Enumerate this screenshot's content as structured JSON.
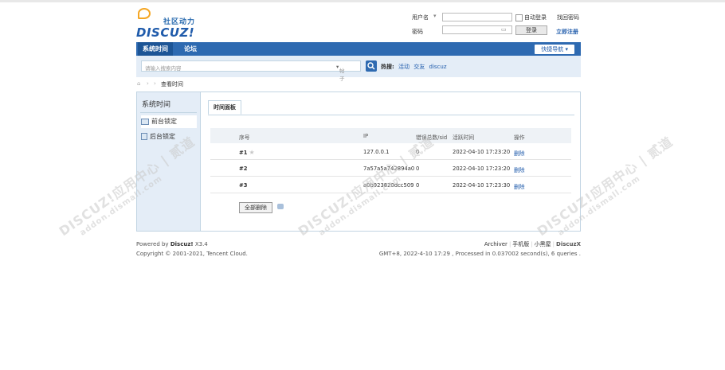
{
  "header": {
    "slogan": "社区动力",
    "brand": "DISCUZ!",
    "login": {
      "username_label": "用户名",
      "password_label": "密码",
      "auto_login_label": "自动登录",
      "forgot_password": "找回密码",
      "login_button": "登录",
      "register_link": "立即注册"
    }
  },
  "nav": {
    "items": [
      {
        "label": "系统时间"
      },
      {
        "label": "论坛"
      }
    ],
    "quick_nav": "快捷导航"
  },
  "search": {
    "placeholder": "请输入搜索内容",
    "scope": "帖子",
    "hot_label": "热搜:",
    "hot_words": [
      "活动",
      "交友",
      "discuz"
    ]
  },
  "breadcrumb": {
    "current": "查看时间"
  },
  "sidebar": {
    "title": "系统时间",
    "items": [
      {
        "label": "前台锁定"
      },
      {
        "label": "后台锁定"
      }
    ]
  },
  "panel": {
    "tab": "时间面板",
    "columns": [
      "序号",
      "IP",
      "错误总数/sid",
      "活跃时间",
      "操作"
    ],
    "rows": [
      {
        "no": "#1",
        "ip": "127.0.0.1",
        "count": "0",
        "time": "2022-04-10 17:23:20",
        "action": "删除"
      },
      {
        "no": "#2",
        "ip": "7a57a5a742894a0",
        "count": "0",
        "time": "2022-04-10 17:23:20",
        "action": "删除"
      },
      {
        "no": "#3",
        "ip": "a0b923820dcc509",
        "count": "0",
        "time": "2022-04-10 17:23:30",
        "action": "删除"
      }
    ],
    "delete_all": "全部删除"
  },
  "footer": {
    "powered_prefix": "Powered by",
    "powered_brand": "Discuz!",
    "powered_version": "X3.4",
    "copyright": "Copyright © 2001-2021, Tencent Cloud.",
    "links": [
      "Archiver",
      "手机版",
      "小黑屋"
    ],
    "brand_right": "DiscuzX",
    "stats": "GMT+8, 2022-4-10 17:29 , Processed in 0.037002 second(s), 6 queries ."
  },
  "watermark": {
    "line1": "DISCUZ!应用中心 | 贰道",
    "line2": "addon.dismall.com"
  }
}
